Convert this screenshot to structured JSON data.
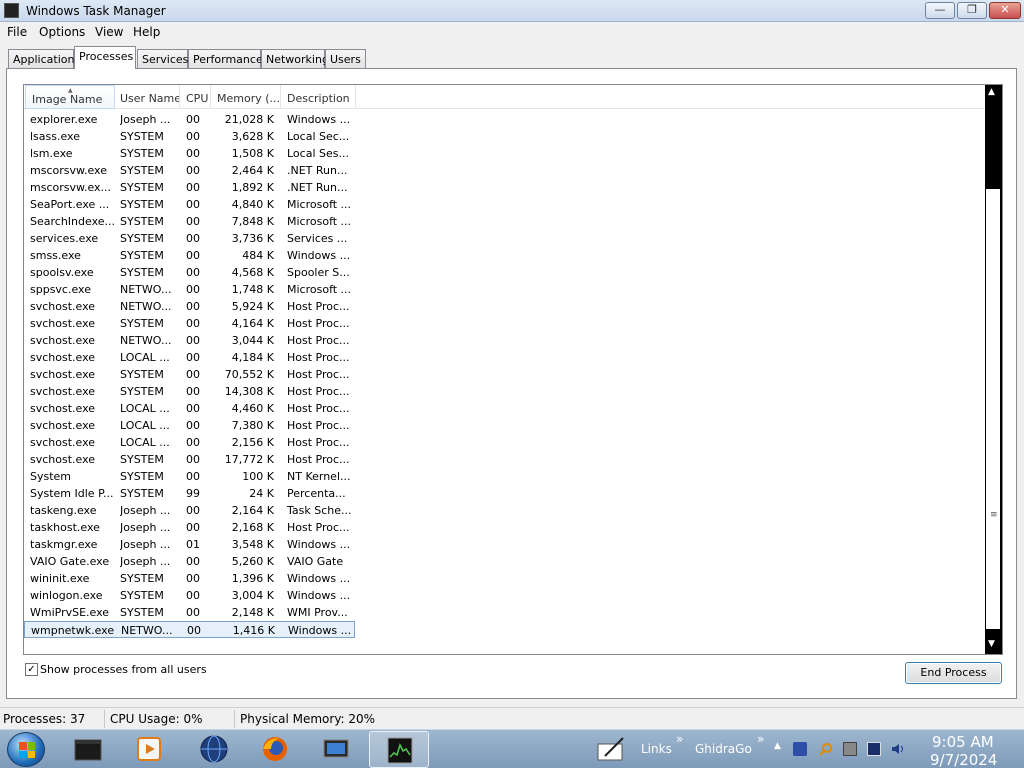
{
  "window": {
    "title": "Windows Task Manager",
    "minimize": "—",
    "restore": "❐",
    "close": "✕"
  },
  "menu": [
    "File",
    "Options",
    "View",
    "Help"
  ],
  "tabs": [
    "Applications",
    "Processes",
    "Services",
    "Performance",
    "Networking",
    "Users"
  ],
  "active_tab": "Processes",
  "columns": [
    "Image Name",
    "User Name",
    "CPU",
    "Memory (...",
    "Description"
  ],
  "processes": [
    {
      "name": "explorer.exe",
      "user": "Joseph ...",
      "cpu": "00",
      "mem": "21,028 K",
      "desc": "Windows ..."
    },
    {
      "name": "lsass.exe",
      "user": "SYSTEM",
      "cpu": "00",
      "mem": "3,628 K",
      "desc": "Local Sec..."
    },
    {
      "name": "lsm.exe",
      "user": "SYSTEM",
      "cpu": "00",
      "mem": "1,508 K",
      "desc": "Local Ses..."
    },
    {
      "name": "mscorsvw.exe",
      "user": "SYSTEM",
      "cpu": "00",
      "mem": "2,464 K",
      "desc": ".NET Run..."
    },
    {
      "name": "mscorsvw.ex...",
      "user": "SYSTEM",
      "cpu": "00",
      "mem": "1,892 K",
      "desc": ".NET Run..."
    },
    {
      "name": "SeaPort.exe ...",
      "user": "SYSTEM",
      "cpu": "00",
      "mem": "4,840 K",
      "desc": "Microsoft ..."
    },
    {
      "name": "SearchIndexe...",
      "user": "SYSTEM",
      "cpu": "00",
      "mem": "7,848 K",
      "desc": "Microsoft ..."
    },
    {
      "name": "services.exe",
      "user": "SYSTEM",
      "cpu": "00",
      "mem": "3,736 K",
      "desc": "Services ..."
    },
    {
      "name": "smss.exe",
      "user": "SYSTEM",
      "cpu": "00",
      "mem": "484 K",
      "desc": "Windows ..."
    },
    {
      "name": "spoolsv.exe",
      "user": "SYSTEM",
      "cpu": "00",
      "mem": "4,568 K",
      "desc": "Spooler S..."
    },
    {
      "name": "sppsvc.exe",
      "user": "NETWO...",
      "cpu": "00",
      "mem": "1,748 K",
      "desc": "Microsoft ..."
    },
    {
      "name": "svchost.exe",
      "user": "NETWO...",
      "cpu": "00",
      "mem": "5,924 K",
      "desc": "Host Proc..."
    },
    {
      "name": "svchost.exe",
      "user": "SYSTEM",
      "cpu": "00",
      "mem": "4,164 K",
      "desc": "Host Proc..."
    },
    {
      "name": "svchost.exe",
      "user": "NETWO...",
      "cpu": "00",
      "mem": "3,044 K",
      "desc": "Host Proc..."
    },
    {
      "name": "svchost.exe",
      "user": "LOCAL ...",
      "cpu": "00",
      "mem": "4,184 K",
      "desc": "Host Proc..."
    },
    {
      "name": "svchost.exe",
      "user": "SYSTEM",
      "cpu": "00",
      "mem": "70,552 K",
      "desc": "Host Proc..."
    },
    {
      "name": "svchost.exe",
      "user": "SYSTEM",
      "cpu": "00",
      "mem": "14,308 K",
      "desc": "Host Proc..."
    },
    {
      "name": "svchost.exe",
      "user": "LOCAL ...",
      "cpu": "00",
      "mem": "4,460 K",
      "desc": "Host Proc..."
    },
    {
      "name": "svchost.exe",
      "user": "LOCAL ...",
      "cpu": "00",
      "mem": "7,380 K",
      "desc": "Host Proc..."
    },
    {
      "name": "svchost.exe",
      "user": "LOCAL ...",
      "cpu": "00",
      "mem": "2,156 K",
      "desc": "Host Proc..."
    },
    {
      "name": "svchost.exe",
      "user": "SYSTEM",
      "cpu": "00",
      "mem": "17,772 K",
      "desc": "Host Proc..."
    },
    {
      "name": "System",
      "user": "SYSTEM",
      "cpu": "00",
      "mem": "100 K",
      "desc": "NT Kernel..."
    },
    {
      "name": "System Idle P...",
      "user": "SYSTEM",
      "cpu": "99",
      "mem": "24 K",
      "desc": "Percenta..."
    },
    {
      "name": "taskeng.exe",
      "user": "Joseph ...",
      "cpu": "00",
      "mem": "2,164 K",
      "desc": "Task Sche..."
    },
    {
      "name": "taskhost.exe",
      "user": "Joseph ...",
      "cpu": "00",
      "mem": "2,168 K",
      "desc": "Host Proc..."
    },
    {
      "name": "taskmgr.exe",
      "user": "Joseph ...",
      "cpu": "01",
      "mem": "3,548 K",
      "desc": "Windows ..."
    },
    {
      "name": "VAIO Gate.exe",
      "user": "Joseph ...",
      "cpu": "00",
      "mem": "5,260 K",
      "desc": "VAIO Gate"
    },
    {
      "name": "wininit.exe",
      "user": "SYSTEM",
      "cpu": "00",
      "mem": "1,396 K",
      "desc": "Windows ..."
    },
    {
      "name": "winlogon.exe",
      "user": "SYSTEM",
      "cpu": "00",
      "mem": "3,004 K",
      "desc": "Windows ..."
    },
    {
      "name": "WmiPrvSE.exe",
      "user": "SYSTEM",
      "cpu": "00",
      "mem": "2,148 K",
      "desc": "WMI Prov..."
    },
    {
      "name": "wmpnetwk.exe",
      "user": "NETWO...",
      "cpu": "00",
      "mem": "1,416 K",
      "desc": "Windows ...",
      "selected": true
    }
  ],
  "show_all_users": {
    "label": "Show processes from all users",
    "checked": true,
    "mark": "✓"
  },
  "end_process_label": "End Process",
  "status": {
    "processes": "Processes: 37",
    "cpu": "CPU Usage: 0%",
    "memory": "Physical Memory: 20%"
  },
  "taskbar": {
    "links_label": "Links",
    "ghidra_label": "GhidraGo",
    "chevron": "»",
    "tray_arrow": "▲",
    "time": "9:05 AM",
    "date": "9/7/2024"
  },
  "icons": {
    "app": "task-manager-icon",
    "scroll_up": "▲",
    "scroll_down": "▼",
    "grip": "≡",
    "sort": "▲"
  }
}
